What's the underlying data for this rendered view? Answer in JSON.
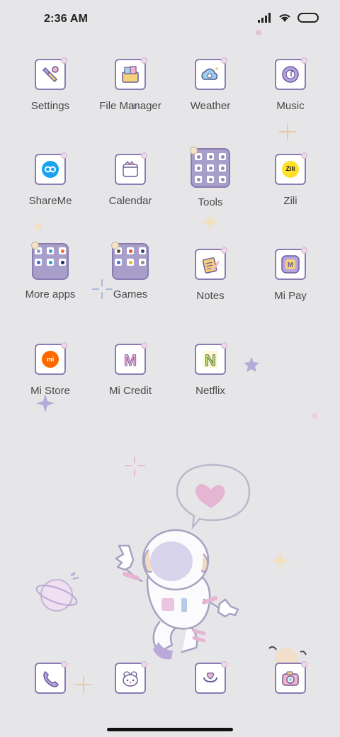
{
  "status": {
    "time": "2:36 AM",
    "icons": [
      "signal-icon",
      "wifi-icon",
      "battery-icon"
    ]
  },
  "apps": [
    {
      "label": "Settings",
      "icon": "settings-icon"
    },
    {
      "label": "File Manager",
      "icon": "file-manager-icon"
    },
    {
      "label": "Weather",
      "icon": "weather-icon"
    },
    {
      "label": "Music",
      "icon": "music-icon"
    },
    {
      "label": "ShareMe",
      "icon": "shareme-icon"
    },
    {
      "label": "Calendar",
      "icon": "calendar-icon"
    },
    {
      "label": "Tools",
      "icon": "tools-folder-icon"
    },
    {
      "label": "Zili",
      "icon": "zili-icon",
      "icon_text": "Zili"
    },
    {
      "label": "More apps",
      "icon": "more-apps-folder-icon"
    },
    {
      "label": "Games",
      "icon": "games-folder-icon"
    },
    {
      "label": "Notes",
      "icon": "notes-icon"
    },
    {
      "label": "Mi Pay",
      "icon": "mi-pay-icon",
      "icon_text": "M"
    },
    {
      "label": "Mi Store",
      "icon": "mi-store-icon",
      "icon_text": "mi"
    },
    {
      "label": "Mi Credit",
      "icon": "mi-credit-icon",
      "icon_text": "M"
    },
    {
      "label": "Netflix",
      "icon": "netflix-icon",
      "icon_text": "N"
    }
  ],
  "dock": [
    {
      "icon": "phone-icon"
    },
    {
      "icon": "messaging-icon"
    },
    {
      "icon": "browser-icon"
    },
    {
      "icon": "camera-icon"
    }
  ],
  "colors": {
    "background": "#e6e5e8",
    "icon_frame": "#8b7bb5",
    "folder": "#a79ec9",
    "accent_pink": "#e9b7d4",
    "mi_orange": "#ff6900"
  }
}
